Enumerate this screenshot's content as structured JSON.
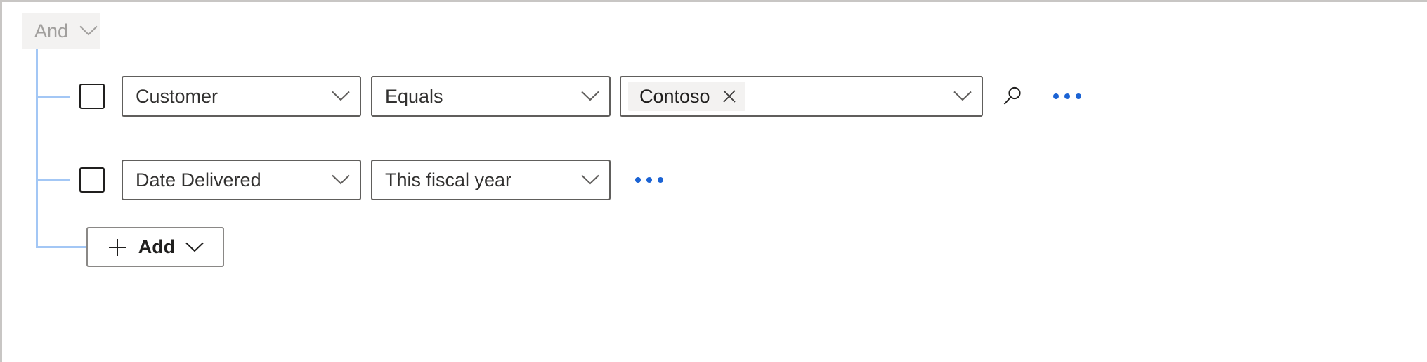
{
  "panel": {
    "group_operator": {
      "label": "And",
      "chevron_icon": "chevron-down-icon"
    },
    "rows": [
      {
        "checkbox_checked": false,
        "field": {
          "value": "Customer",
          "chevron_icon": "chevron-down-icon"
        },
        "operator": {
          "value": "Equals",
          "chevron_icon": "chevron-down-icon"
        },
        "value_field": {
          "tags": [
            {
              "label": "Contoso",
              "remove_icon": "close-icon"
            }
          ],
          "chevron_icon": "chevron-down-icon"
        },
        "search_icon": "search-icon",
        "overflow_label": "more-options"
      },
      {
        "checkbox_checked": false,
        "field": {
          "value": "Date Delivered",
          "chevron_icon": "chevron-down-icon"
        },
        "operator": {
          "value": "This fiscal year",
          "chevron_icon": "chevron-down-icon"
        },
        "overflow_label": "more-options"
      }
    ],
    "add_button": {
      "label": "Add",
      "plus_icon": "plus-icon",
      "chevron_icon": "chevron-down-icon"
    }
  },
  "colors": {
    "tree_line": "#a3c7f5",
    "chip_background": "#f3f2f1",
    "chip_text": "#a19f9d",
    "field_border": "#605e5c",
    "text": "#323130",
    "accent_dots": "#1b63d4",
    "panel_border": "#c8c6c4"
  }
}
